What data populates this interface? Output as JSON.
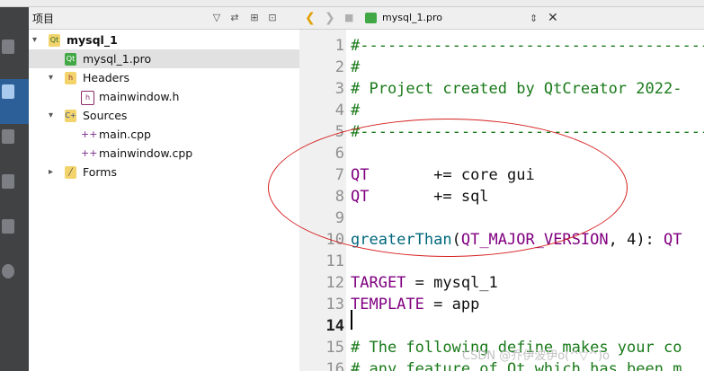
{
  "pane": {
    "title": "项目"
  },
  "tree": [
    {
      "label": "mysql_1",
      "icon": "qt-project-icon",
      "arrow": "▾",
      "bold": true
    },
    {
      "label": "mysql_1.pro",
      "icon": "pro-file-icon",
      "arrow": "",
      "bold": false,
      "selected": true
    },
    {
      "label": "Headers",
      "icon": "headers-folder-icon",
      "arrow": "▾",
      "bold": false
    },
    {
      "label": "mainwindow.h",
      "icon": "header-file-icon",
      "arrow": "",
      "bold": false
    },
    {
      "label": "Sources",
      "icon": "sources-folder-icon",
      "arrow": "▾",
      "bold": false
    },
    {
      "label": "main.cpp",
      "icon": "cpp-file-icon",
      "arrow": "",
      "bold": false
    },
    {
      "label": "mainwindow.cpp",
      "icon": "cpp-file-icon",
      "arrow": "",
      "bold": false
    },
    {
      "label": "Forms",
      "icon": "forms-folder-icon",
      "arrow": "▸",
      "bold": false
    }
  ],
  "editor": {
    "document": "mysql_1.pro",
    "current_line": 14,
    "lines": [
      {
        "n": "1",
        "text": "#-------------------------------------------------"
      },
      {
        "n": "2",
        "text": "#"
      },
      {
        "n": "3",
        "text": "# Project created by QtCreator 2022-"
      },
      {
        "n": "4",
        "text": "#"
      },
      {
        "n": "5",
        "text": "#-------------------------------------------------"
      },
      {
        "n": "6",
        "text": ""
      },
      {
        "n": "7",
        "text": "QT       += core gui"
      },
      {
        "n": "8",
        "text": "QT       += sql"
      },
      {
        "n": "9",
        "text": ""
      },
      {
        "n": "10",
        "text": "greaterThan(QT_MAJOR_VERSION, 4): QT"
      },
      {
        "n": "11",
        "text": ""
      },
      {
        "n": "12",
        "text": "TARGET = mysql_1"
      },
      {
        "n": "13",
        "text": "TEMPLATE = app"
      },
      {
        "n": "14",
        "text": ""
      },
      {
        "n": "15",
        "text": "# The following define makes your co"
      },
      {
        "n": "16",
        "text": "# any feature of Qt which has been m"
      }
    ]
  },
  "watermark": "CSDN @乔伊波伊o(^▽^)o"
}
